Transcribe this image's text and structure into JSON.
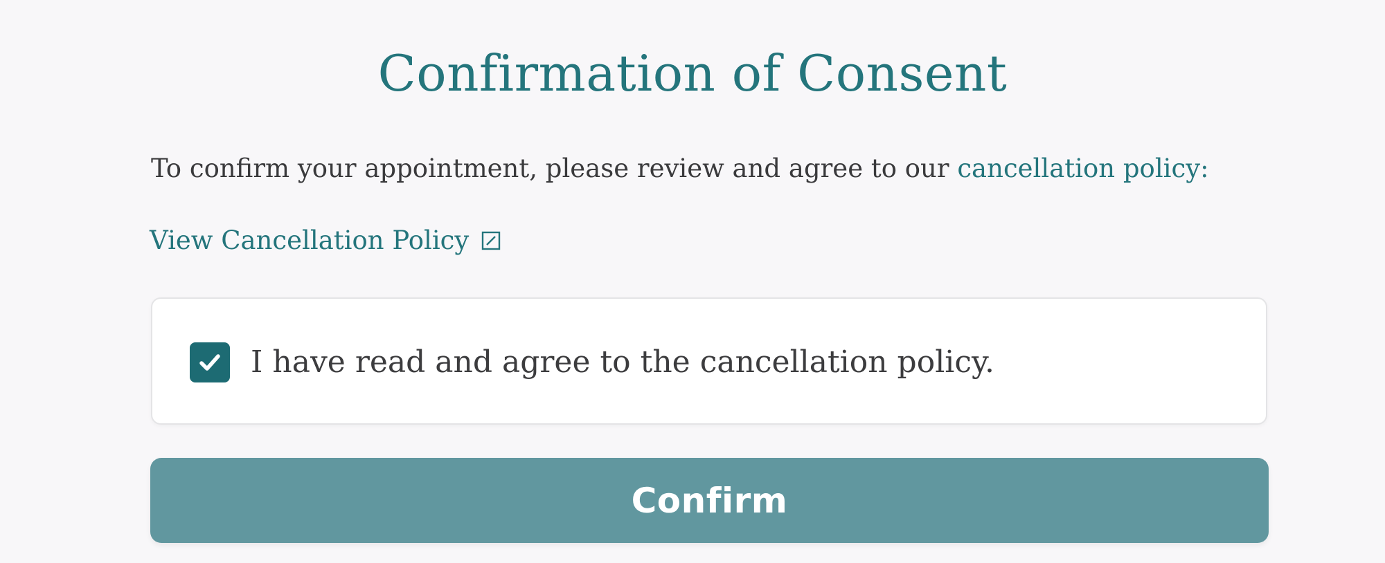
{
  "title": "Confirmation of Consent",
  "intro": {
    "text": "To confirm your appointment, please review and agree to our ",
    "link_text": "cancellation policy:"
  },
  "view_policy": {
    "label": "View Cancellation Policy",
    "icon": "external-link-icon"
  },
  "consent": {
    "checked": true,
    "label": "I have read and agree to the cancellation policy.",
    "icon": "checkmark-icon"
  },
  "confirm_button": {
    "label": "Confirm"
  },
  "colors": {
    "accent": "#24757c",
    "checkbox_fill": "#1d6b73",
    "button_fill": "#61979f",
    "background": "#f8f7f9"
  }
}
